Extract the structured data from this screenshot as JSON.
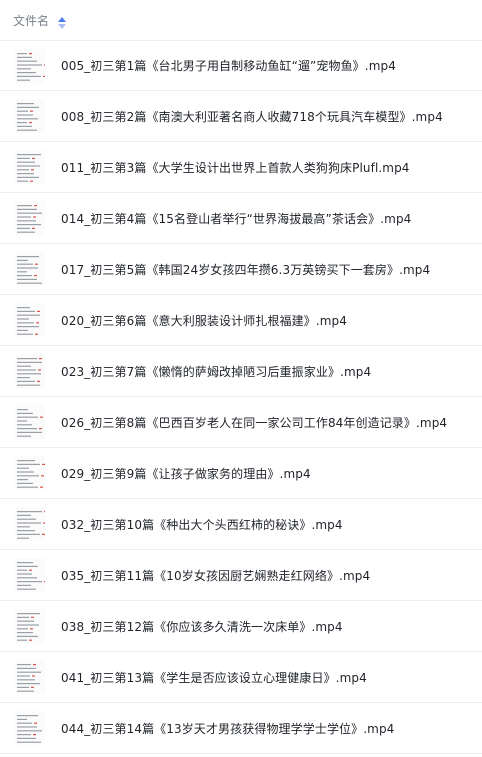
{
  "header": {
    "column_label": "文件名",
    "sort_icon": "sort-icon",
    "sort_color": "#4c7bf3"
  },
  "files": [
    {
      "name": "005_初三第1篇《台北男子用自制移动鱼缸“遛”宠物鱼》.mp4"
    },
    {
      "name": "008_初三第2篇《南澳大利亚著名商人收藏718个玩具汽车模型》.mp4"
    },
    {
      "name": "011_初三第3篇《大学生设计出世界上首款人类狗狗床Plufl.mp4"
    },
    {
      "name": "014_初三第4篇《15名登山者举行“世界海拔最高”茶话会》.mp4"
    },
    {
      "name": "017_初三第5篇《韩国24岁女孩四年攒6.3万英镑买下一套房》.mp4"
    },
    {
      "name": "020_初三第6篇《意大利服装设计师扎根福建》.mp4"
    },
    {
      "name": "023_初三第7篇《懒惰的萨姆改掉陋习后重振家业》.mp4"
    },
    {
      "name": "026_初三第8篇《巴西百岁老人在同一家公司工作84年创造记录》.mp4"
    },
    {
      "name": "029_初三第9篇《让孩子做家务的理由》.mp4"
    },
    {
      "name": "032_初三第10篇《种出大个头西红柿的秘诀》.mp4"
    },
    {
      "name": "035_初三第11篇《10岁女孩因厨艺娴熟走红网络》.mp4"
    },
    {
      "name": "038_初三第12篇《你应该多久清洗一次床单》.mp4"
    },
    {
      "name": "041_初三第13篇《学生是否应该设立心理健康日》.mp4"
    },
    {
      "name": "044_初三第14篇《13岁天才男孩获得物理学学士学位》.mp4"
    }
  ]
}
